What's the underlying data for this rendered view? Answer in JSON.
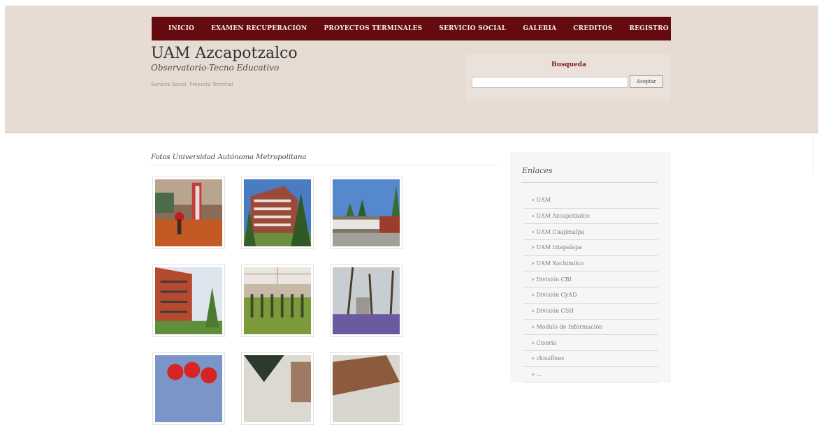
{
  "nav": {
    "items": [
      {
        "label": "INICIO"
      },
      {
        "label": "EXAMEN RECUPERACIÓN"
      },
      {
        "label": "PROYECTOS TERMINALES"
      },
      {
        "label": "SERVICIO SOCIAL"
      },
      {
        "label": "GALERIA"
      },
      {
        "label": "CREDITOS"
      },
      {
        "label": "REGISTRO"
      }
    ]
  },
  "header": {
    "title": "UAM Azcapotzalco",
    "subtitle": "Observatorio-Tecno Educativo",
    "tagline": "Servicio Social, Proyecto Terminal"
  },
  "search": {
    "label": "Busqueda",
    "value": "",
    "placeholder": "",
    "button_label": "Aceptar"
  },
  "gallery": {
    "title": "Fotos Universidad Autónoma Metropolitana",
    "photos": [
      {
        "alt": "photo-1"
      },
      {
        "alt": "photo-2"
      },
      {
        "alt": "photo-3"
      },
      {
        "alt": "photo-4"
      },
      {
        "alt": "photo-5"
      },
      {
        "alt": "photo-6"
      },
      {
        "alt": "photo-7"
      },
      {
        "alt": "photo-8"
      },
      {
        "alt": "photo-9"
      }
    ]
  },
  "sidebar": {
    "title": "Enlaces",
    "links": [
      {
        "label": "» UAM"
      },
      {
        "label": "» UAM Azcapotzalco"
      },
      {
        "label": "» UAM Cuajimalpa"
      },
      {
        "label": "» UAM Iztapalapa"
      },
      {
        "label": "» UAM Xochimilco"
      },
      {
        "label": "» División CBI"
      },
      {
        "label": "» División CyAD"
      },
      {
        "label": "» División CSH"
      },
      {
        "label": "» Modulo de Información"
      },
      {
        "label": "» Cisoria"
      },
      {
        "label": "» chissfines"
      },
      {
        "label": "» ..."
      }
    ]
  },
  "colors": {
    "nav_bg": "#640b10",
    "header_bg": "#e7dcd3",
    "accent_label": "#7b1a1a"
  }
}
